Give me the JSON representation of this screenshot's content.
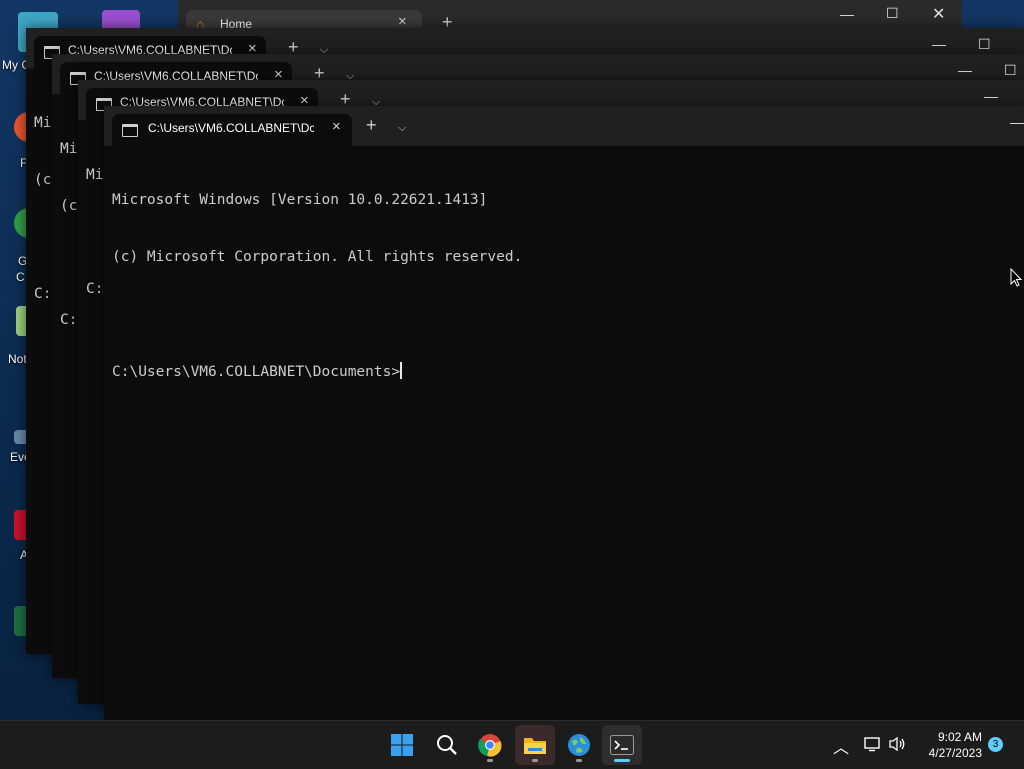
{
  "desktop": {
    "icons": [
      {
        "label": "My C"
      },
      {
        "label": "F"
      },
      {
        "label": "G"
      },
      {
        "label": "C"
      },
      {
        "label": "Not"
      },
      {
        "label": "Eve"
      },
      {
        "label": "A"
      }
    ]
  },
  "background_window": {
    "tab_title": "Home"
  },
  "terminal_windows": [
    {
      "tab_title": "C:\\Users\\VM6.COLLABNET\\Dc",
      "lines": [
        "Mi",
        "(c",
        "",
        "C:"
      ]
    },
    {
      "tab_title": "C:\\Users\\VM6.COLLABNET\\Dc",
      "lines": [
        "Mi",
        "(c",
        "",
        "C:"
      ]
    },
    {
      "tab_title": "C:\\Users\\VM6.COLLABNET\\Dc",
      "lines": [
        "Mi",
        "",
        "C:"
      ]
    }
  ],
  "active_terminal": {
    "tab_title": "C:\\Users\\VM6.COLLABNET\\Dc",
    "line1": "Microsoft Windows [Version 10.0.22621.1413]",
    "line2": "(c) Microsoft Corporation. All rights reserved.",
    "prompt": "C:\\Users\\VM6.COLLABNET\\Documents>"
  },
  "taskbar": {
    "apps": [
      {
        "name": "start-button"
      },
      {
        "name": "search-button"
      },
      {
        "name": "chrome"
      },
      {
        "name": "file-explorer"
      },
      {
        "name": "network-app"
      },
      {
        "name": "terminal"
      }
    ],
    "time": "9:02 AM",
    "date": "4/27/2023",
    "notification_count": "3"
  },
  "colors": {
    "accent": "#60cdff",
    "terminal_bg": "#0c0c0c",
    "titlebar_bg": "#202020"
  }
}
